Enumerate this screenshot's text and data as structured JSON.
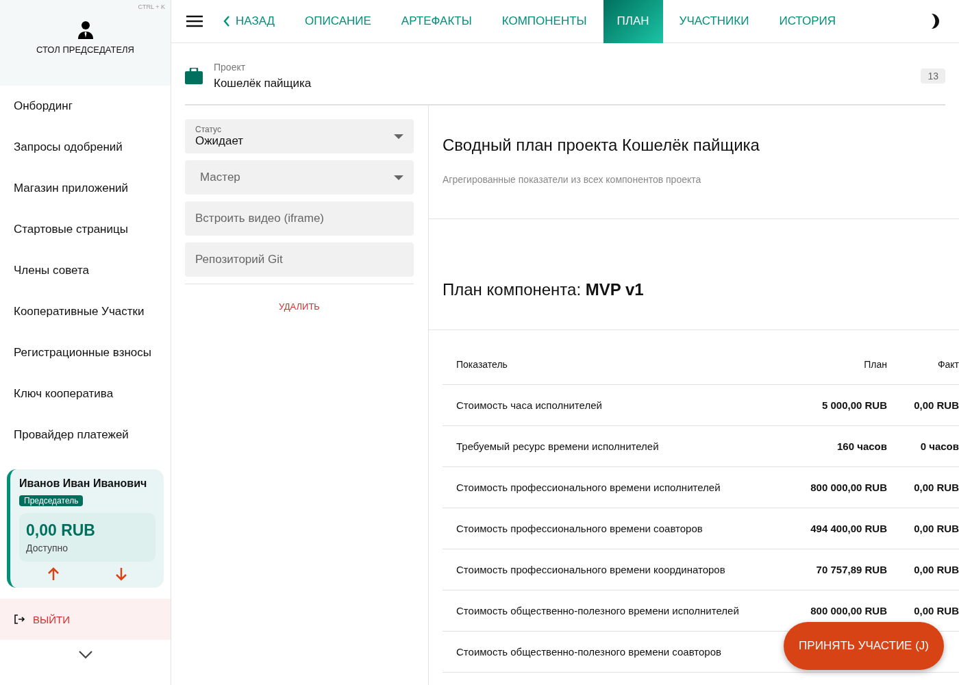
{
  "sidebar": {
    "shortcut": "CTRL + K",
    "title": "СТОЛ ПРЕДСЕДАТЕЛЯ",
    "items": [
      {
        "label": "Онбординг",
        "selected": false
      },
      {
        "label": "Запросы одобрений",
        "selected": false
      },
      {
        "label": "Магазин приложений",
        "selected": false
      },
      {
        "label": "Стартовые страницы",
        "selected": false
      },
      {
        "label": "Члены совета",
        "selected": false
      },
      {
        "label": "Кооперативные Участки",
        "selected": false
      },
      {
        "label": "Регистрационные взносы",
        "selected": false
      },
      {
        "label": "Ключ кооператива",
        "selected": false
      },
      {
        "label": "Провайдер платежей",
        "selected": false
      }
    ],
    "user": {
      "name": "Иванов Иван Иванович",
      "role": "Председатель",
      "balance": "0,00 RUB",
      "balance_label": "Доступно"
    },
    "logout": "ВЫЙТИ"
  },
  "nav": {
    "back": "НАЗАД",
    "tabs": [
      {
        "label": "ОПИСАНИЕ",
        "selected": false
      },
      {
        "label": "АРТЕФАКТЫ",
        "selected": false
      },
      {
        "label": "КОМПОНЕНТЫ",
        "selected": false
      },
      {
        "label": "ПЛАН",
        "selected": true
      },
      {
        "label": "УЧАСТНИКИ",
        "selected": false
      },
      {
        "label": "ИСТОРИЯ",
        "selected": false
      }
    ]
  },
  "project": {
    "label": "Проект",
    "name": "Кошелёк пайщика",
    "count": "13"
  },
  "form": {
    "status": {
      "label": "Статус",
      "value": "Ожидает"
    },
    "master": {
      "value": "Мастер"
    },
    "video": {
      "placeholder": "Встроить видео (iframe)"
    },
    "git": {
      "placeholder": "Репозиторий Git"
    },
    "delete": "УДАЛИТЬ"
  },
  "summary": {
    "title": "Сводный план проекта Кошелёк пайщика",
    "subtitle": "Агрегированные показатели из всех компонентов проекта"
  },
  "component": {
    "title_prefix": "План компонента: ",
    "title_name": "MVP v1"
  },
  "table": {
    "columns": [
      "Показатель",
      "План",
      "Факт"
    ],
    "rows": [
      {
        "metric": "Стоимость часа исполнителей",
        "plan": "5 000,00 RUB",
        "fact": "0,00 RUB"
      },
      {
        "metric": "Требуемый ресурс времени исполнителей",
        "plan": "160 часов",
        "fact": "0 часов"
      },
      {
        "metric": "Стоимость профессионального времени исполнителей",
        "plan": "800 000,00 RUB",
        "fact": "0,00 RUB"
      },
      {
        "metric": "Стоимость профессионального времени соавторов",
        "plan": "494 400,00 RUB",
        "fact": "0,00 RUB"
      },
      {
        "metric": "Стоимость профессионального времени координаторов",
        "plan": "70 757,89 RUB",
        "fact": "0,00 RUB"
      },
      {
        "metric": "Стоимость общественно-полезного времени исполнителей",
        "plan": "800 000,00 RUB",
        "fact": "0,00 RUB"
      },
      {
        "metric": "Стоимость общественно-полезного времени соавторов"
      }
    ]
  },
  "fab": "ПРИНЯТЬ УЧАСТИЕ (J)"
}
